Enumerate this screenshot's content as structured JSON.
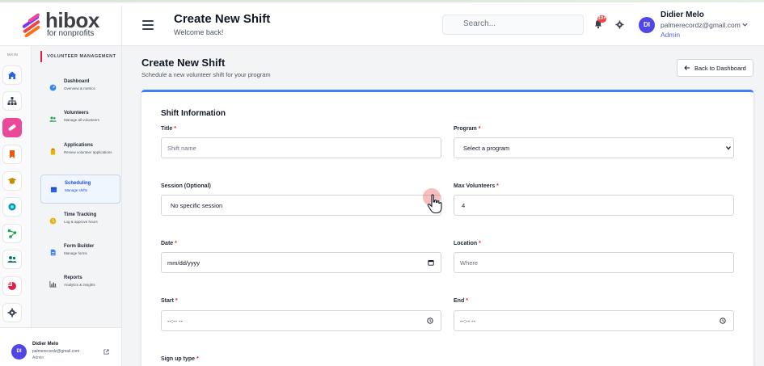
{
  "header": {
    "logo_word": "hibox",
    "logo_sub": "for nonprofits",
    "title": "Create New Shift",
    "subtitle": "Welcome back!",
    "search_placeholder": "Search...",
    "notification_count": "10+",
    "user": {
      "initials": "DI",
      "name": "Didier Melo",
      "email": "palmerecordz@gmail.com",
      "role": "Admin"
    }
  },
  "rail": {
    "label": "MAIN",
    "icons": [
      "home-icon",
      "sitemap-icon",
      "bandage-icon",
      "bookmark-icon",
      "graduation-cap-icon",
      "circle-icon",
      "network-icon",
      "users-icon",
      "pie-chart-icon",
      "settings-icon"
    ]
  },
  "sidebar": {
    "section": "VOLUNTEER MANAGEMENT",
    "items": [
      {
        "title": "Dashboard",
        "sub": "Overview & metrics",
        "icon": "gauge-icon",
        "active": false
      },
      {
        "title": "Volunteers",
        "sub": "Manage all volunteers",
        "icon": "people-icon",
        "active": false
      },
      {
        "title": "Applications",
        "sub": "Review volunteer applications",
        "icon": "clipboard-icon",
        "active": false
      },
      {
        "title": "Scheduling",
        "sub": "Manage shifts",
        "icon": "calendar-icon",
        "active": true
      },
      {
        "title": "Time Tracking",
        "sub": "Log & approve hours",
        "icon": "clock-icon",
        "active": false
      },
      {
        "title": "Form Builder",
        "sub": "Manage forms",
        "icon": "document-icon",
        "active": false
      },
      {
        "title": "Reports",
        "sub": "Analytics & insights",
        "icon": "bar-chart-icon",
        "active": false
      }
    ],
    "footer": {
      "initials": "DI",
      "name": "Didier Melo",
      "email": "palmerecordz@gmail.com",
      "role": "Admin"
    }
  },
  "main": {
    "title": "Create New Shift",
    "subtitle": "Schedule a new volunteer shift for your program",
    "back_label": "Back to Dashboard",
    "card_title": "Shift Information",
    "fields": {
      "title": {
        "label": "Title",
        "placeholder": "Shift name"
      },
      "program": {
        "label": "Program",
        "value": "Select a program"
      },
      "session": {
        "label": "Session (Optional)",
        "value": "No specific session"
      },
      "max_volunteers": {
        "label": "Max Volunteers",
        "value": "4"
      },
      "date": {
        "label": "Date",
        "placeholder": "mm/dd/yyyy"
      },
      "location": {
        "label": "Location",
        "placeholder": "Where"
      },
      "start": {
        "label": "Start",
        "placeholder": "--:-- --"
      },
      "end": {
        "label": "End",
        "placeholder": "--:-- --"
      },
      "signup_type": {
        "label": "Sign up type"
      }
    },
    "required_mark": "*"
  },
  "colors": {
    "accent_blue": "#3b82f6",
    "brand_pink": "#ec4899",
    "avatar_indigo": "#4f46e5",
    "required_red": "#dc2626"
  }
}
